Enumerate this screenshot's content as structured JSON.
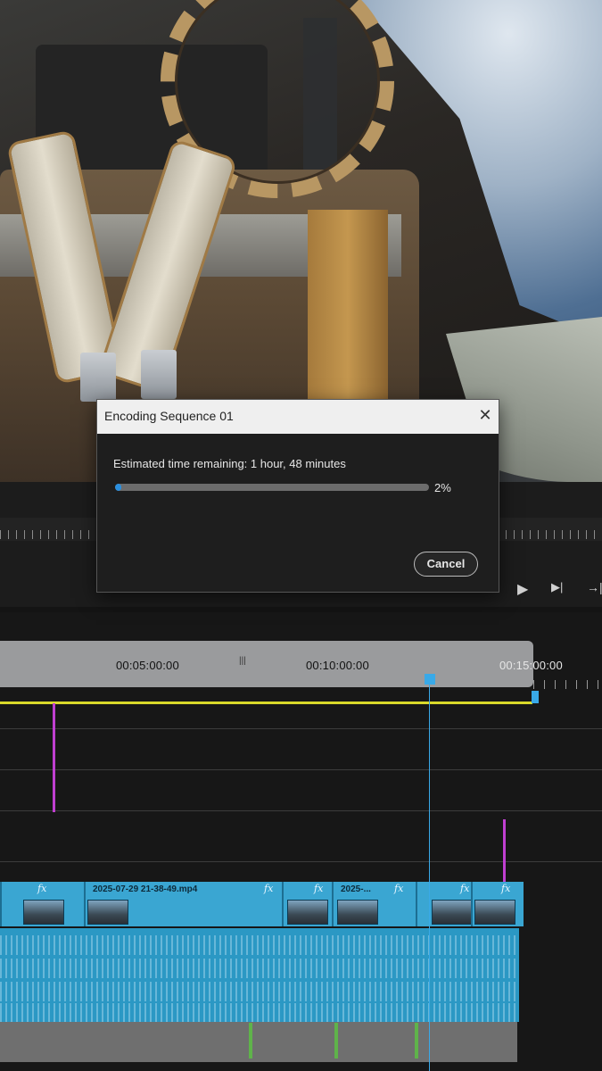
{
  "dialog": {
    "title": "Encoding Sequence 01",
    "close_icon": "close-icon",
    "status": "Estimated time remaining: 1 hour, 48 minutes",
    "progress_percent": 2,
    "progress_label": "2%",
    "cancel_label": "Cancel"
  },
  "timeline": {
    "timecodes": [
      "00:05:00:00",
      "00:10:00:00",
      "00:15:00:00"
    ],
    "clips": [
      {
        "label": "2025-07-29 21-38-49.mp4"
      },
      {
        "label": "2025-..."
      }
    ],
    "fx_label": "fx"
  },
  "transport": {
    "icons": [
      "play-icon",
      "step-forward-icon",
      "export-frame-icon"
    ],
    "glyphs": [
      "▶",
      "▶|",
      "→|"
    ]
  },
  "colors": {
    "accent": "#2a8fdf",
    "clip": "#3aa6d2",
    "playhead": "#39a9e8",
    "in_out_line": "#d9d92a",
    "marker": "#c03fd1"
  }
}
